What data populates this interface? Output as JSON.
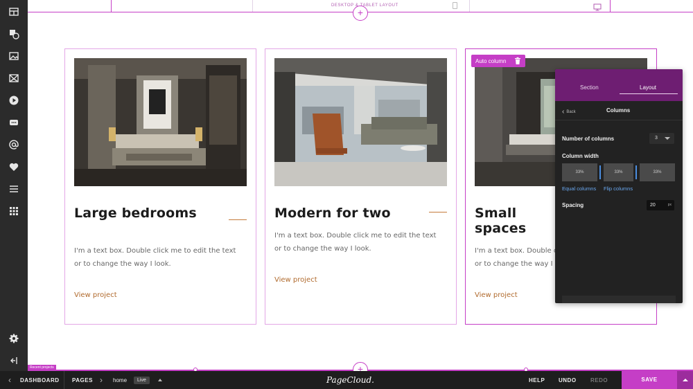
{
  "top_bar": {
    "layout_label": "DESKTOP & TABLET LAYOUT"
  },
  "cards": [
    {
      "title": "Large bedrooms",
      "body": "I'm a text box. Double click me to edit the text or to change the way I look.",
      "link": "View project"
    },
    {
      "title": "Modern for two",
      "body": "I'm a text box. Double click me to edit the text or to change the way I look.",
      "link": "View project"
    },
    {
      "title": "Small spaces",
      "body": "I'm a text box. Double click me to edit the text or to change the way I look.",
      "link": "View project"
    }
  ],
  "auto_column": {
    "label": "Auto column"
  },
  "panel": {
    "tabs": [
      "Section",
      "Layout"
    ],
    "active_tab": "Layout",
    "back_label": "Back",
    "title": "Columns",
    "number_of_columns_label": "Number of columns",
    "number_of_columns_value": "3",
    "column_width_label": "Column width",
    "column_widths": [
      "33%",
      "33%",
      "33%"
    ],
    "equal_columns": "Equal columns",
    "flip_columns": "Flip columns",
    "spacing_label": "Spacing",
    "spacing_value": "20",
    "spacing_unit": "px"
  },
  "recent_projects": "Recent projects",
  "bottom_bar": {
    "dashboard": "DASHBOARD",
    "pages": "PAGES",
    "page_name": "home",
    "live_badge": "Live",
    "logo": "PageCloud.",
    "help": "HELP",
    "undo": "UNDO",
    "redo": "REDO",
    "save": "SAVE"
  },
  "icons": {
    "left_toolbar": [
      "section-icon",
      "shapes-icon",
      "image-icon",
      "gallery-icon",
      "video-icon",
      "chat-icon",
      "at-sign-icon",
      "heart-icon",
      "menu-icon",
      "apps-grid-icon",
      "settings-gear-icon",
      "collapse-panel-icon"
    ]
  },
  "colors": {
    "accent": "#c53ec6",
    "panel_header": "#6e1e72",
    "link": "#b06a2d",
    "toolbar": "#2b2b2b"
  }
}
